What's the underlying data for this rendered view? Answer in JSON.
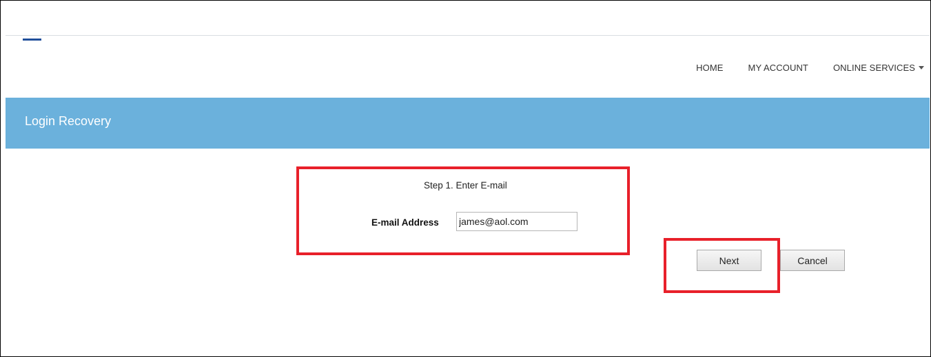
{
  "nav": {
    "items": [
      {
        "label": "HOME"
      },
      {
        "label": "MY ACCOUNT"
      },
      {
        "label": "ONLINE SERVICES",
        "has_dropdown": true
      }
    ]
  },
  "banner": {
    "title": "Login Recovery",
    "color": "#6bb1dc"
  },
  "form": {
    "step_title": "Step 1. Enter E-mail",
    "email_label": "E-mail Address",
    "email_value": "james@aol.com"
  },
  "buttons": {
    "next_label": "Next",
    "cancel_label": "Cancel"
  },
  "highlight_color": "#e8202a"
}
